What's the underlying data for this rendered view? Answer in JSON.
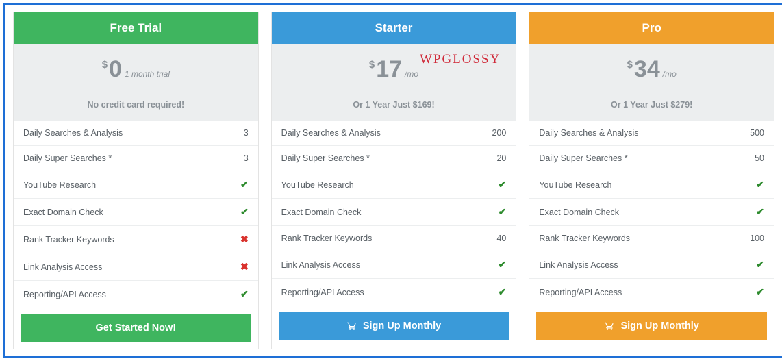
{
  "watermark": "WPGLOSSY",
  "feature_labels": [
    "Daily Searches & Analysis",
    "Daily Super Searches *",
    "YouTube Research",
    "Exact Domain Check",
    "Rank Tracker Keywords",
    "Link Analysis Access",
    "Reporting/API Access"
  ],
  "plans": [
    {
      "id": "free-trial",
      "name": "Free Trial",
      "header_color": "#3fb55f",
      "currency": "$",
      "amount": "0",
      "period": "1 month trial",
      "subline": "No credit card required!",
      "button_label": "Get Started Now!",
      "button_color": "#3fb55f",
      "button_icon": false,
      "features": [
        "3",
        "3",
        "check",
        "check",
        "cross",
        "cross",
        "check"
      ]
    },
    {
      "id": "starter",
      "name": "Starter",
      "header_color": "#3a9ad9",
      "currency": "$",
      "amount": "17",
      "period": "/mo",
      "subline": "Or 1 Year Just $169!",
      "button_label": "Sign Up Monthly",
      "button_color": "#3a9ad9",
      "button_icon": true,
      "features": [
        "200",
        "20",
        "check",
        "check",
        "40",
        "check",
        "check"
      ]
    },
    {
      "id": "pro",
      "name": "Pro",
      "header_color": "#f0a02c",
      "currency": "$",
      "amount": "34",
      "period": "/mo",
      "subline": "Or 1 Year Just $279!",
      "button_label": "Sign Up Monthly",
      "button_color": "#f0a02c",
      "button_icon": true,
      "features": [
        "500",
        "50",
        "check",
        "check",
        "100",
        "check",
        "check"
      ]
    }
  ]
}
